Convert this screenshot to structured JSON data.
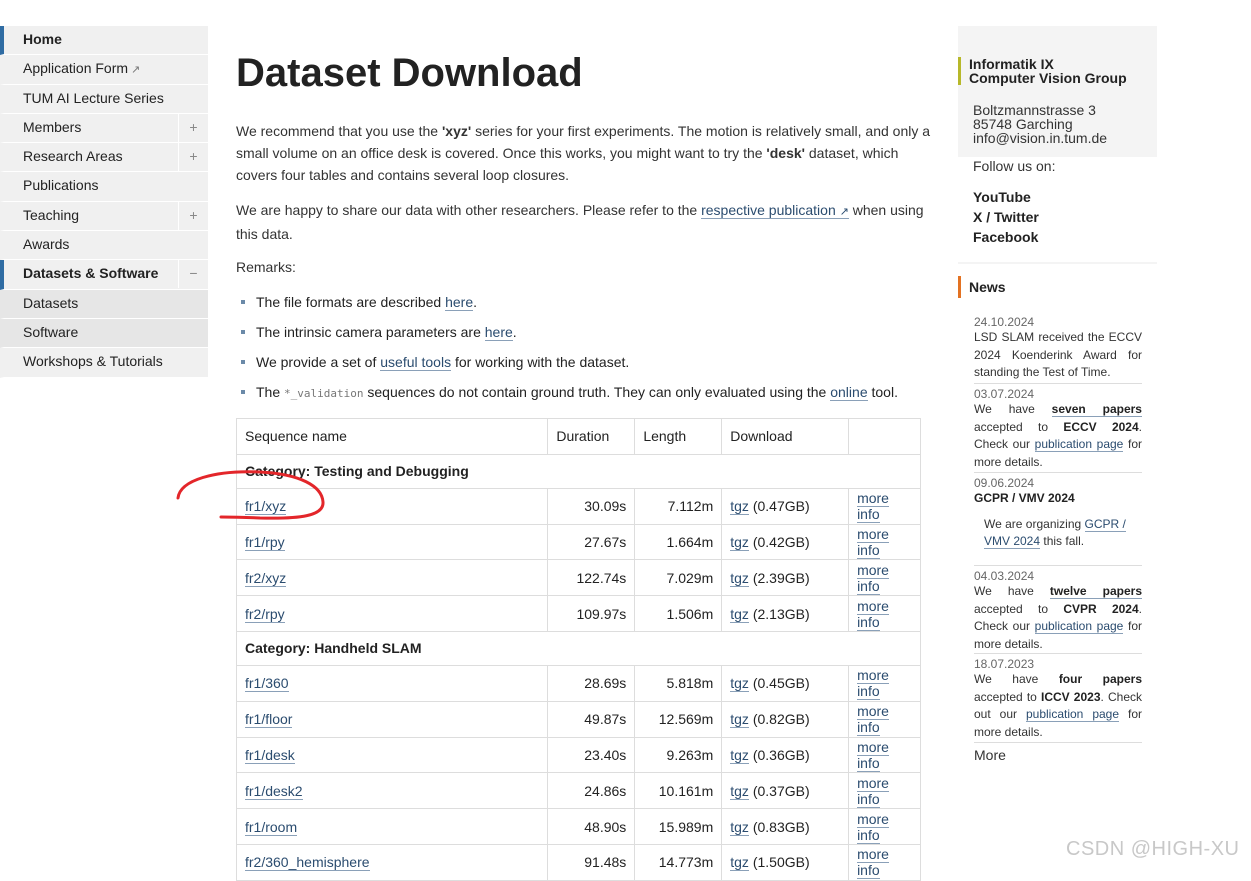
{
  "nav": {
    "items": [
      {
        "label": "Home",
        "active": true
      },
      {
        "label": "Application Form",
        "external": "↗"
      },
      {
        "label": "TUM AI Lecture Series"
      },
      {
        "label": "Members",
        "toggle": "+"
      },
      {
        "label": "Research Areas",
        "toggle": "+"
      },
      {
        "label": "Publications"
      },
      {
        "label": "Teaching",
        "toggle": "+"
      },
      {
        "label": "Awards"
      },
      {
        "label": "Datasets & Software",
        "active": true,
        "toggle": "−"
      },
      {
        "label": "Datasets",
        "sub": true
      },
      {
        "label": "Software",
        "sub": true
      },
      {
        "label": "Workshops & Tutorials"
      }
    ]
  },
  "main": {
    "title": "Dataset Download",
    "intro": {
      "t1": "We recommend that you use the ",
      "b1": "'xyz'",
      "t2": " series for your first experiments. The motion is relatively small, and only a small volume on an office desk is covered. Once this works, you might want to try the ",
      "b2": "'desk'",
      "t3": " dataset, which covers four tables and contains several loop closures."
    },
    "share": {
      "t1": "We are happy to share our data with other researchers. Please refer to the ",
      "link": "respective publication",
      "ext": "↗",
      "t2": " when using this data."
    },
    "remarks_label": "Remarks:",
    "remarks": {
      "r1": {
        "t1": "The file formats are described ",
        "link": "here",
        "t2": "."
      },
      "r2": {
        "t1": "The intrinsic camera parameters are ",
        "link": "here",
        "t2": "."
      },
      "r3": {
        "t1": "We provide a set of ",
        "link": "useful tools",
        "t2": " for working with the dataset."
      },
      "r4": {
        "t1": "The ",
        "code": "*_validation",
        "t2": " sequences do not contain ground truth. They can only evaluated using the ",
        "link": "online",
        "t3": " tool."
      }
    },
    "table": {
      "headers": {
        "name": "Sequence name",
        "duration": "Duration",
        "length": "Length",
        "download": "Download"
      },
      "link_tgz": "tgz",
      "link_more": "more info",
      "rows": [
        {
          "category": "Category: Testing and Debugging"
        },
        {
          "name": "fr1/xyz",
          "duration": "30.09s",
          "length": "7.112m",
          "size": "(0.47GB)"
        },
        {
          "name": "fr1/rpy",
          "duration": "27.67s",
          "length": "1.664m",
          "size": "(0.42GB)"
        },
        {
          "name": "fr2/xyz",
          "duration": "122.74s",
          "length": "7.029m",
          "size": "(2.39GB)"
        },
        {
          "name": "fr2/rpy",
          "duration": "109.97s",
          "length": "1.506m",
          "size": "(2.13GB)"
        },
        {
          "category": "Category: Handheld SLAM"
        },
        {
          "name": "fr1/360",
          "duration": "28.69s",
          "length": "5.818m",
          "size": "(0.45GB)"
        },
        {
          "name": "fr1/floor",
          "duration": "49.87s",
          "length": "12.569m",
          "size": "(0.82GB)"
        },
        {
          "name": "fr1/desk",
          "duration": "23.40s",
          "length": "9.263m",
          "size": "(0.36GB)"
        },
        {
          "name": "fr1/desk2",
          "duration": "24.86s",
          "length": "10.161m",
          "size": "(0.37GB)"
        },
        {
          "name": "fr1/room",
          "duration": "48.90s",
          "length": "15.989m",
          "size": "(0.83GB)"
        },
        {
          "name": "fr2/360_hemisphere",
          "duration": "91.48s",
          "length": "14.773m",
          "size": "(1.50GB)"
        }
      ]
    }
  },
  "right": {
    "group": {
      "l1": "Informatik IX",
      "l2": "Computer Vision Group"
    },
    "address": {
      "street": "Boltzmannstrasse 3",
      "city": "85748 Garching",
      "email": "info@vision.in.tum.de"
    },
    "follow": "Follow us on:",
    "social": {
      "youtube": "YouTube",
      "x": "X / Twitter",
      "facebook": "Facebook"
    },
    "news_title": "News",
    "news": {
      "n1": {
        "date": "24.10.2024",
        "text": "LSD SLAM received the ECCV 2024 Koenderink Award for standing the Test of Time."
      },
      "n2": {
        "date": "03.07.2024",
        "t1": "We have ",
        "link": "seven papers",
        "t2": " accepted to ",
        "b": "ECCV 2024",
        "t3": ". Check our ",
        "link2": "publication page",
        "t4": " for more details."
      },
      "n3": {
        "date": "09.06.2024",
        "title": "GCPR / VMV 2024",
        "t1": "We are organizing ",
        "link": "GCPR / VMV 2024",
        "t2": " this fall."
      },
      "n4": {
        "date": "04.03.2024",
        "t1": "We have ",
        "link": "twelve papers",
        "t2": " accepted to ",
        "b": "CVPR 2024",
        "t3": ". Check our ",
        "link2": "publication page",
        "t4": " for more details."
      },
      "n5": {
        "date": "18.07.2023",
        "t1": "We have ",
        "b1": "four papers",
        "t2": " accepted to ",
        "b": "ICCV 2023",
        "t3": ". Check out our ",
        "link2": "publication page",
        "t4": " for more details."
      }
    },
    "more": "More"
  },
  "watermark": "CSDN @HIGH-XU",
  "colors": {
    "accent_blue": "#2f6ca3",
    "group_bar": "#b7b82a",
    "news_bar": "#e37222",
    "annotation_red": "#e3262a"
  }
}
